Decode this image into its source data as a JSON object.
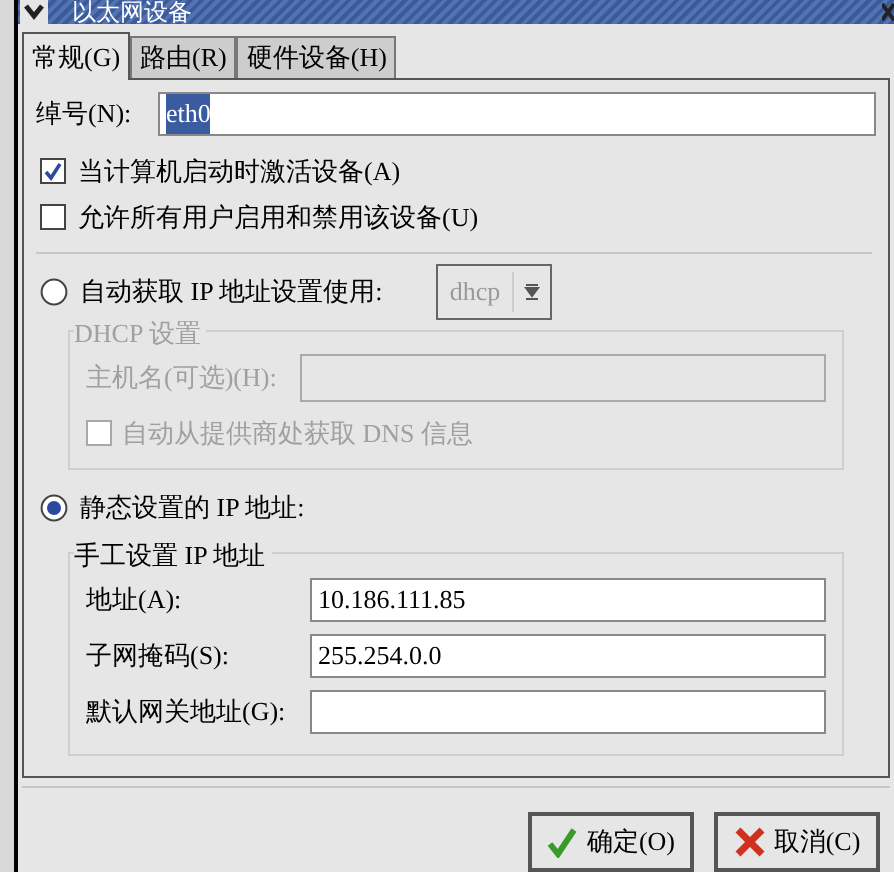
{
  "window": {
    "title": "以太网设备"
  },
  "tabs": [
    {
      "label": "常规(G)",
      "selected": true
    },
    {
      "label": "路由(R)",
      "selected": false
    },
    {
      "label": "硬件设备(H)",
      "selected": false
    }
  ],
  "nickname": {
    "label": "绰号(N):",
    "value": "eth0",
    "highlighted": true
  },
  "checkboxes": [
    {
      "label": "当计算机启动时激活设备(A)",
      "checked": true
    },
    {
      "label": "允许所有用户启用和禁用该设备(U)",
      "checked": false
    }
  ],
  "auto_ip": {
    "label": "自动获取 IP 地址设置使用:",
    "selected": false,
    "combo_value": "dhcp"
  },
  "dhcp_group": {
    "title": "DHCP 设置",
    "disabled": true,
    "hostname_label": "主机名(可选)(H):",
    "dns_label": "自动从提供商处获取 DNS 信息",
    "dns_checked": false
  },
  "static_ip": {
    "label": "静态设置的 IP 地址:",
    "selected": true
  },
  "manual_group": {
    "title": "手工设置 IP 地址",
    "fields": [
      {
        "label": "地址(A):",
        "value": "10.186.111.85"
      },
      {
        "label": "子网掩码(S):",
        "value": "255.254.0.0"
      },
      {
        "label": "默认网关地址(G):"
      }
    ]
  },
  "buttons": [
    {
      "label": "确定(O)",
      "kind": "ok"
    },
    {
      "label": "取消(C)",
      "kind": "cancel"
    }
  ]
}
